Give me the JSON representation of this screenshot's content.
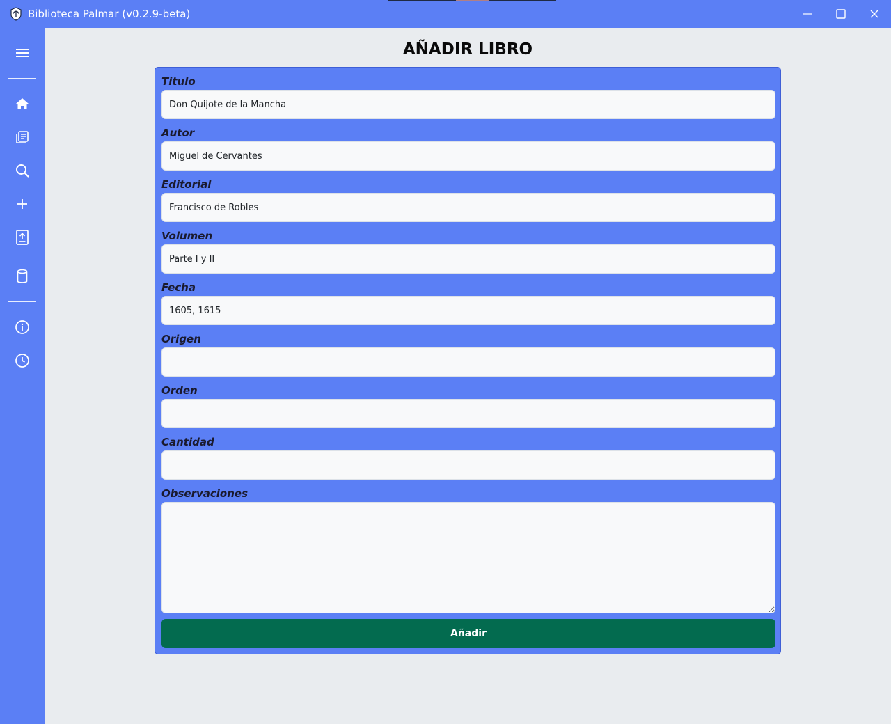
{
  "window": {
    "title": "Biblioteca Palmar (v0.2.9-beta)",
    "app_icon": "palm-logo-icon",
    "controls": [
      "minimize-icon",
      "maximize-icon",
      "close-icon"
    ]
  },
  "sidebar": {
    "items": [
      {
        "id": "menu",
        "icon": "hamburger-menu-icon"
      },
      {
        "id": "home",
        "icon": "home-icon"
      },
      {
        "id": "books",
        "icon": "books-icon"
      },
      {
        "id": "search",
        "icon": "search-icon"
      },
      {
        "id": "add",
        "icon": "plus-icon"
      },
      {
        "id": "import",
        "icon": "upload-file-icon"
      },
      {
        "id": "database",
        "icon": "database-icon"
      },
      {
        "id": "info",
        "icon": "info-icon"
      },
      {
        "id": "history",
        "icon": "clock-icon"
      }
    ]
  },
  "page": {
    "title": "AÑADIR LIBRO"
  },
  "form": {
    "fields": [
      {
        "label": "Titulo",
        "value": "Don Quijote de la Mancha",
        "placeholder": ""
      },
      {
        "label": "Autor",
        "value": "Miguel de Cervantes",
        "placeholder": ""
      },
      {
        "label": "Editorial",
        "value": "Francisco de Robles",
        "placeholder": ""
      },
      {
        "label": "Volumen",
        "value": "Parte I y II",
        "placeholder": ""
      },
      {
        "label": "Fecha",
        "value": "1605, 1615",
        "placeholder": ""
      },
      {
        "label": "Origen",
        "value": "",
        "placeholder": ""
      },
      {
        "label": "Orden",
        "value": "",
        "placeholder": ""
      },
      {
        "label": "Cantidad",
        "value": "",
        "placeholder": ""
      }
    ],
    "observaciones": {
      "label": "Observaciones",
      "value": ""
    },
    "submit_label": "Añadir"
  },
  "colors": {
    "accent": "#5b7ff5",
    "submit": "#036b4f",
    "background": "#e9ecef",
    "input_bg": "#f8f9fa"
  }
}
